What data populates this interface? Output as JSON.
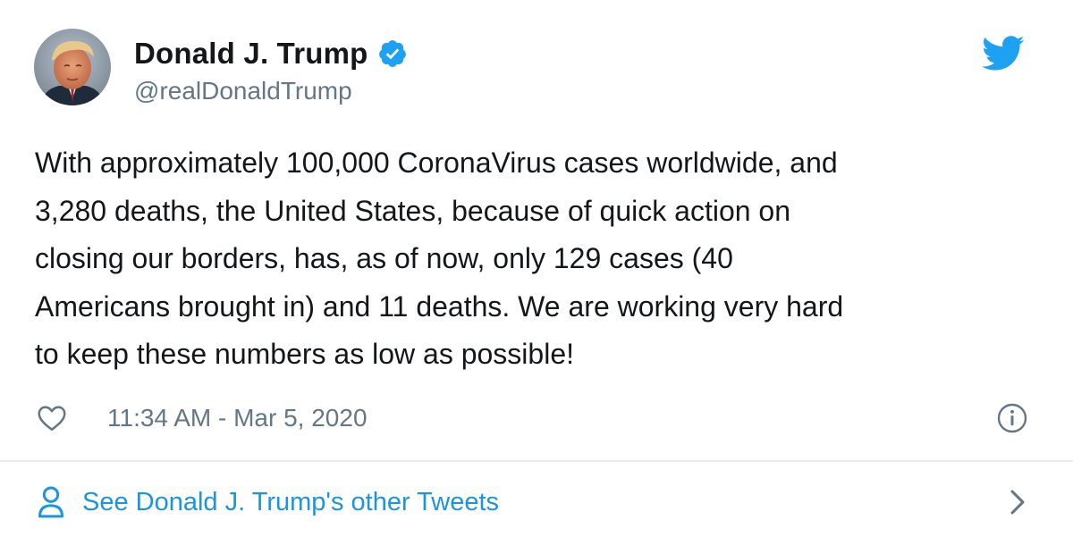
{
  "author": {
    "name": "Donald J. Trump",
    "handle": "@realDonaldTrump",
    "verified": true
  },
  "tweet": {
    "text_lines": [
      "With approximately 100,000 CoronaVirus cases worldwide, and",
      "3,280 deaths, the United States, because of quick action on",
      "closing our borders, has, as of now, only 129 cases (40",
      "Americans brought in) and 11 deaths. We are working very hard",
      "to keep these numbers as low as possible!"
    ],
    "timestamp": "11:34 AM - Mar 5, 2020"
  },
  "footer": {
    "other_tweets_label": "See Donald J. Trump's other Tweets"
  },
  "icons": {
    "brand": "twitter-bird-icon",
    "verified": "verified-badge-icon",
    "like": "heart-icon",
    "info": "info-icon",
    "person": "person-icon",
    "chevron": "chevron-right-icon"
  },
  "colors": {
    "brand_blue": "#1da1f2",
    "link_blue": "#1b95e0",
    "text": "#14171a",
    "secondary": "#657786",
    "divider": "#e6ecf0"
  }
}
